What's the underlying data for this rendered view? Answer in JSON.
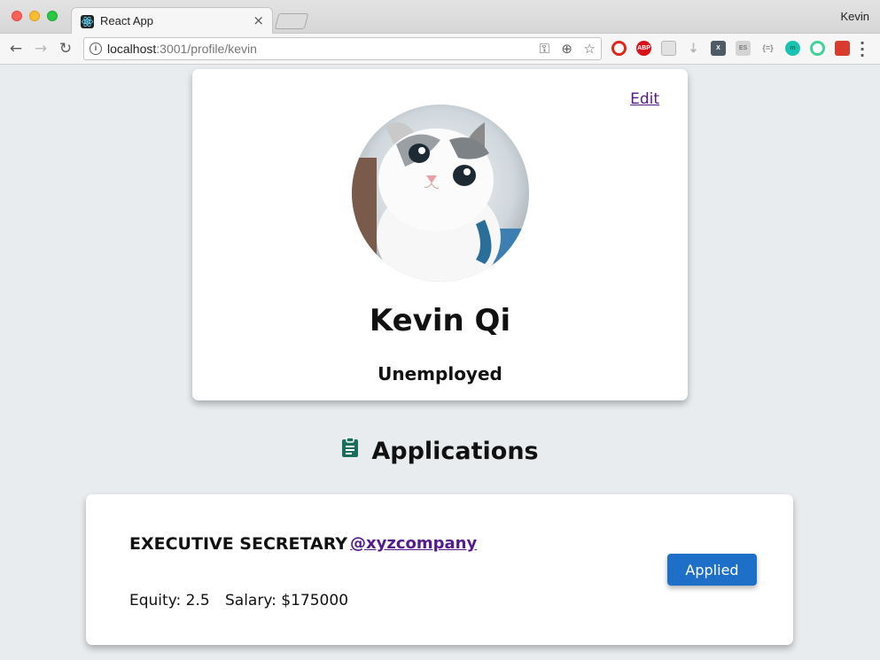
{
  "browser": {
    "tab_title": "React App",
    "tab_close": "×",
    "profile": "Kevin",
    "url_host": "localhost",
    "url_rest": ":3001/profile/kevin",
    "nav": {
      "back": "←",
      "forward": "→",
      "reload": "↻"
    },
    "extensions": {
      "abp": "ABP",
      "x": "X",
      "es": "ES",
      "json": "{=}",
      "m": "m"
    }
  },
  "profile": {
    "edit_label": "Edit",
    "name": "Kevin Qi",
    "status": "Unemployed",
    "avatar": "cat-photo"
  },
  "applications": {
    "heading": "Applications",
    "icon": "clipboard-icon",
    "items": [
      {
        "title": "EXECUTIVE SECRETARY",
        "company": "@xyzcompany",
        "equity_text": "Equity: 2.5",
        "salary_text": "Salary: $175000",
        "status_label": "Applied"
      }
    ]
  },
  "colors": {
    "background": "#e9ecef",
    "link": "#551a8b",
    "button": "#1e6fc8",
    "clipboard_icon": "#1a6e5c"
  }
}
